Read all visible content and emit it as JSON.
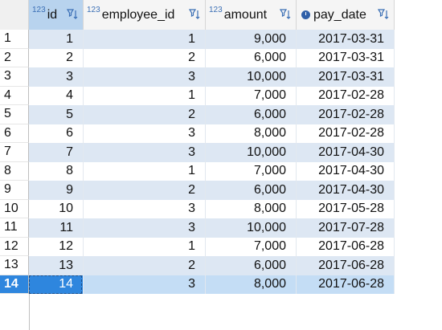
{
  "table": {
    "columns": [
      {
        "key": "id",
        "label": "id",
        "type_icon": "123",
        "key_icon": "primary-key-icon",
        "width": 68
      },
      {
        "key": "employee_id",
        "label": "employee_id",
        "type_icon": "123",
        "width": 152
      },
      {
        "key": "amount",
        "label": "amount",
        "type_icon": "123",
        "width": 113
      },
      {
        "key": "pay_date",
        "label": "pay_date",
        "type_icon": "clock-icon",
        "width": 122
      }
    ],
    "rows": [
      {
        "rownum": "1",
        "id": "1",
        "employee_id": "1",
        "amount": "9,000",
        "pay_date": "2017-03-31"
      },
      {
        "rownum": "2",
        "id": "2",
        "employee_id": "2",
        "amount": "6,000",
        "pay_date": "2017-03-31"
      },
      {
        "rownum": "3",
        "id": "3",
        "employee_id": "3",
        "amount": "10,000",
        "pay_date": "2017-03-31"
      },
      {
        "rownum": "4",
        "id": "4",
        "employee_id": "1",
        "amount": "7,000",
        "pay_date": "2017-02-28"
      },
      {
        "rownum": "5",
        "id": "5",
        "employee_id": "2",
        "amount": "6,000",
        "pay_date": "2017-02-28"
      },
      {
        "rownum": "6",
        "id": "6",
        "employee_id": "3",
        "amount": "8,000",
        "pay_date": "2017-02-28"
      },
      {
        "rownum": "7",
        "id": "7",
        "employee_id": "3",
        "amount": "10,000",
        "pay_date": "2017-04-30"
      },
      {
        "rownum": "8",
        "id": "8",
        "employee_id": "1",
        "amount": "7,000",
        "pay_date": "2017-04-30"
      },
      {
        "rownum": "9",
        "id": "9",
        "employee_id": "2",
        "amount": "6,000",
        "pay_date": "2017-04-30"
      },
      {
        "rownum": "10",
        "id": "10",
        "employee_id": "3",
        "amount": "8,000",
        "pay_date": "2017-05-28"
      },
      {
        "rownum": "11",
        "id": "11",
        "employee_id": "3",
        "amount": "10,000",
        "pay_date": "2017-07-28"
      },
      {
        "rownum": "12",
        "id": "12",
        "employee_id": "1",
        "amount": "7,000",
        "pay_date": "2017-06-28"
      },
      {
        "rownum": "13",
        "id": "13",
        "employee_id": "2",
        "amount": "6,000",
        "pay_date": "2017-06-28"
      },
      {
        "rownum": "14",
        "id": "14",
        "employee_id": "3",
        "amount": "8,000",
        "pay_date": "2017-06-28"
      }
    ],
    "selected_row": 14,
    "colors": {
      "stripe": "#dde7f3",
      "selection": "#2e86de",
      "selected_row": "#c4ddf5",
      "icon": "#3b6fb5"
    }
  }
}
